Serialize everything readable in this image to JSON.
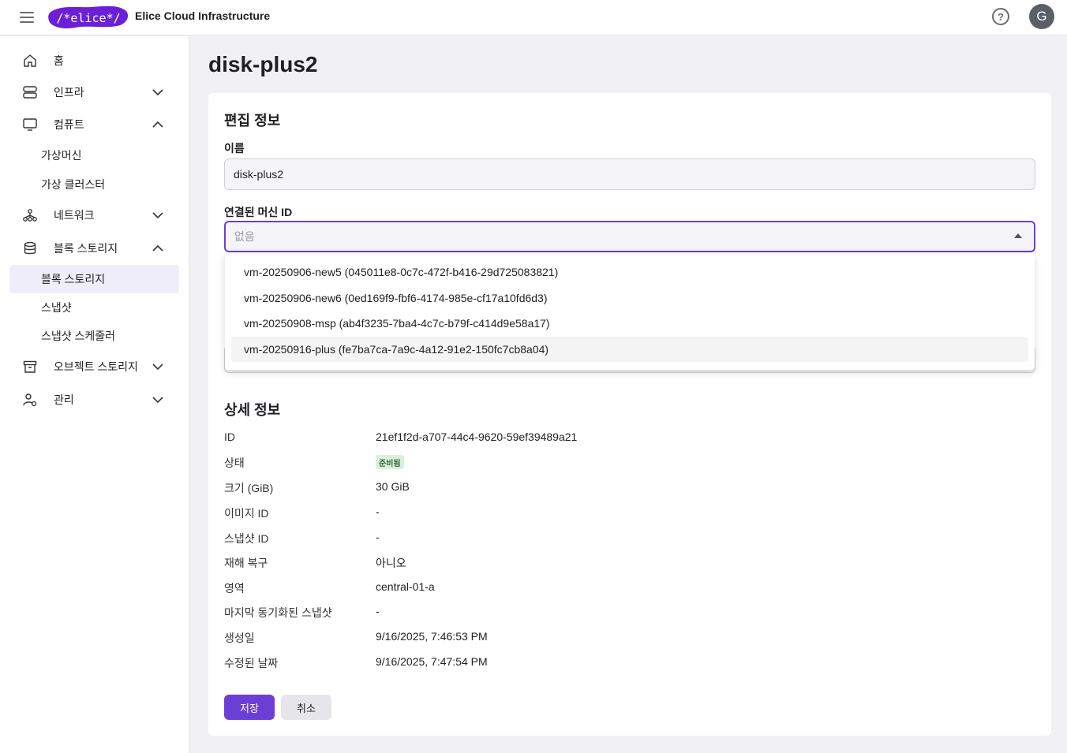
{
  "header": {
    "logo_text": "/*elice*/",
    "app_title": "Elice Cloud Infrastructure",
    "help_label": "?",
    "avatar_initial": "G"
  },
  "sidebar": {
    "items": [
      {
        "label": "홈",
        "icon": "home-icon"
      },
      {
        "label": "인프라",
        "icon": "server-icon"
      },
      {
        "label": "컴퓨트",
        "icon": "monitor-icon"
      },
      {
        "label": "네트워크",
        "icon": "network-icon"
      },
      {
        "label": "블록 스토리지",
        "icon": "database-icon"
      },
      {
        "label": "오브젝트 스토리지",
        "icon": "archive-icon"
      },
      {
        "label": "관리",
        "icon": "user-gear-icon"
      }
    ],
    "compute_sub": [
      "가상머신",
      "가상 클러스터"
    ],
    "storage_sub": [
      "블록 스토리지",
      "스냅샷",
      "스냅샷 스케줄러"
    ]
  },
  "page": {
    "title": "disk-plus2"
  },
  "edit": {
    "section_title": "편집 정보",
    "name_label": "이름",
    "name_value": "disk-plus2",
    "machine_label": "연결된 머신 ID",
    "machine_placeholder": "없음",
    "options": [
      "vm-20250906-new5 (045011e8-0c7c-472f-b416-29d725083821)",
      "vm-20250906-new6 (0ed169f9-fbf6-4174-985e-cf17a10fd6d3)",
      "vm-20250908-msp (ab4f3235-7ba4-4c7c-b79f-c414d9e58a17)",
      "vm-20250916-plus (fe7ba7ca-7a9c-4a12-91e2-150fc7cb8a04)"
    ]
  },
  "details": {
    "section_title": "상세 정보",
    "rows": [
      {
        "key": "ID",
        "value": "21ef1f2d-a707-44c4-9620-59ef39489a21"
      },
      {
        "key": "상태",
        "value": "준비됨"
      },
      {
        "key": "크기 (GiB)",
        "value": "30 GiB"
      },
      {
        "key": "이미지 ID",
        "value": "-"
      },
      {
        "key": "스냅샷 ID",
        "value": "-"
      },
      {
        "key": "재해 복구",
        "value": "아니오"
      },
      {
        "key": "영역",
        "value": "central-01-a"
      },
      {
        "key": "마지막 동기화된 스냅샷",
        "value": "-"
      },
      {
        "key": "생성일",
        "value": "9/16/2025, 7:46:53 PM"
      },
      {
        "key": "수정된 날짜",
        "value": "9/16/2025, 7:47:54 PM"
      }
    ]
  },
  "actions": {
    "save_label": "저장",
    "cancel_label": "취소"
  },
  "colors": {
    "accent": "#6b3fd6",
    "status_ready_bg": "#dcefdc",
    "status_ready_text": "#2f6e35"
  }
}
